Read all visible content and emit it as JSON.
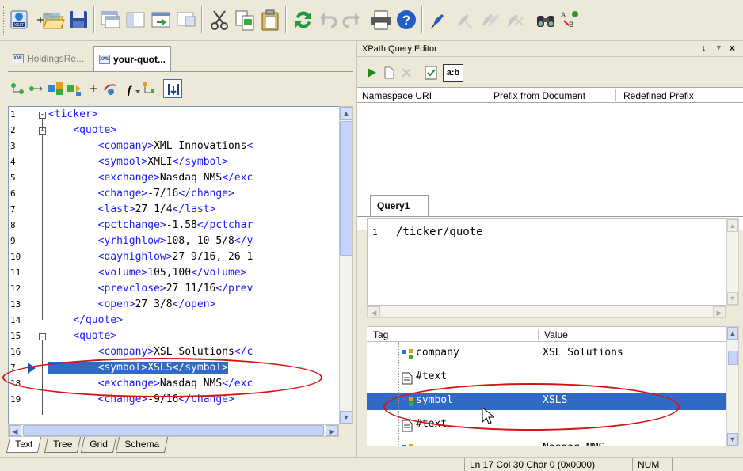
{
  "toolbar": {
    "icons": [
      "xslt-icon",
      "new-icon",
      "open-folder-icon",
      "save-icon",
      "window-icon",
      "window-left-icon",
      "window-split-icon",
      "window-alt-icon",
      "cut-icon",
      "copy-icon",
      "paste-icon",
      "refresh-icon",
      "undo-icon",
      "redo-icon",
      "print-icon",
      "help-icon",
      "pen-icon",
      "pen-remove-icon",
      "pen-remove-all-icon",
      "pen-clear-icon",
      "find-icon",
      "replace-icon"
    ]
  },
  "documents": {
    "tab1_label": "HoldingsRe...",
    "tab2_label": "your-quot...",
    "xml_badge": "XML"
  },
  "editor": {
    "lines": [
      {
        "num": "1",
        "text": "<ticker>"
      },
      {
        "num": "2",
        "text": "    <quote>"
      },
      {
        "num": "3",
        "text": "        <company>XML Innovations<"
      },
      {
        "num": "4",
        "text": "        <symbol>XMLI</symbol>"
      },
      {
        "num": "5",
        "text": "        <exchange>Nasdaq NMS</exc"
      },
      {
        "num": "6",
        "text": "        <change>-7/16</change>"
      },
      {
        "num": "7",
        "text": "        <last>27 1/4</last>"
      },
      {
        "num": "8",
        "text": "        <pctchange>-1.58</pctchar"
      },
      {
        "num": "9",
        "text": "        <yrhighlow>108, 10 5/8</y"
      },
      {
        "num": "10",
        "text": "        <dayhighlow>27 9/16, 26 1"
      },
      {
        "num": "11",
        "text": "        <volume>105,100</volume>"
      },
      {
        "num": "12",
        "text": "        <prevclose>27 11/16</prev"
      },
      {
        "num": "13",
        "text": "        <open>27 3/8</open>"
      },
      {
        "num": "14",
        "text": "    </quote>"
      },
      {
        "num": "15",
        "text": "    <quote>"
      },
      {
        "num": "16",
        "text": "        <company>XSL Solutions</c"
      },
      {
        "num": "17",
        "text": "        <symbol>XSLS</symbol>"
      },
      {
        "num": "18",
        "text": "        <exchange>Nasdaq NMS</exc"
      },
      {
        "num": "19",
        "text": "        <change>-9/16</change>"
      }
    ],
    "current_line_marker": "7",
    "view_tabs": [
      "Text",
      "Tree",
      "Grid",
      "Schema"
    ]
  },
  "xpath": {
    "panel_title": "XPath Query Editor",
    "pin": "↓",
    "close": "×",
    "ab_label": "a:b",
    "ns_columns": [
      "Namespace URI",
      "Prefix from Document",
      "Redefined Prefix"
    ],
    "query_tab": "Query1",
    "query_line": "1",
    "query_text": "/ticker/quote",
    "result_columns": [
      "Tag",
      "Value"
    ],
    "results": [
      {
        "tag": "company",
        "value": "XSL Solutions",
        "kind": "element"
      },
      {
        "tag": "#text",
        "value": "",
        "kind": "text"
      },
      {
        "tag": "symbol",
        "value": "XSLS",
        "kind": "element",
        "selected": true
      },
      {
        "tag": "#text",
        "value": "",
        "kind": "text"
      },
      {
        "tag": "",
        "value": "Nasdaq NMS",
        "kind": "element"
      }
    ]
  },
  "status": {
    "position": "Ln 17 Col 30  Char 0 (0x0000)",
    "mode": "NUM"
  },
  "colors": {
    "accent": "#316ac5",
    "tag": "#1a1aff",
    "annotation": "#d41414"
  }
}
